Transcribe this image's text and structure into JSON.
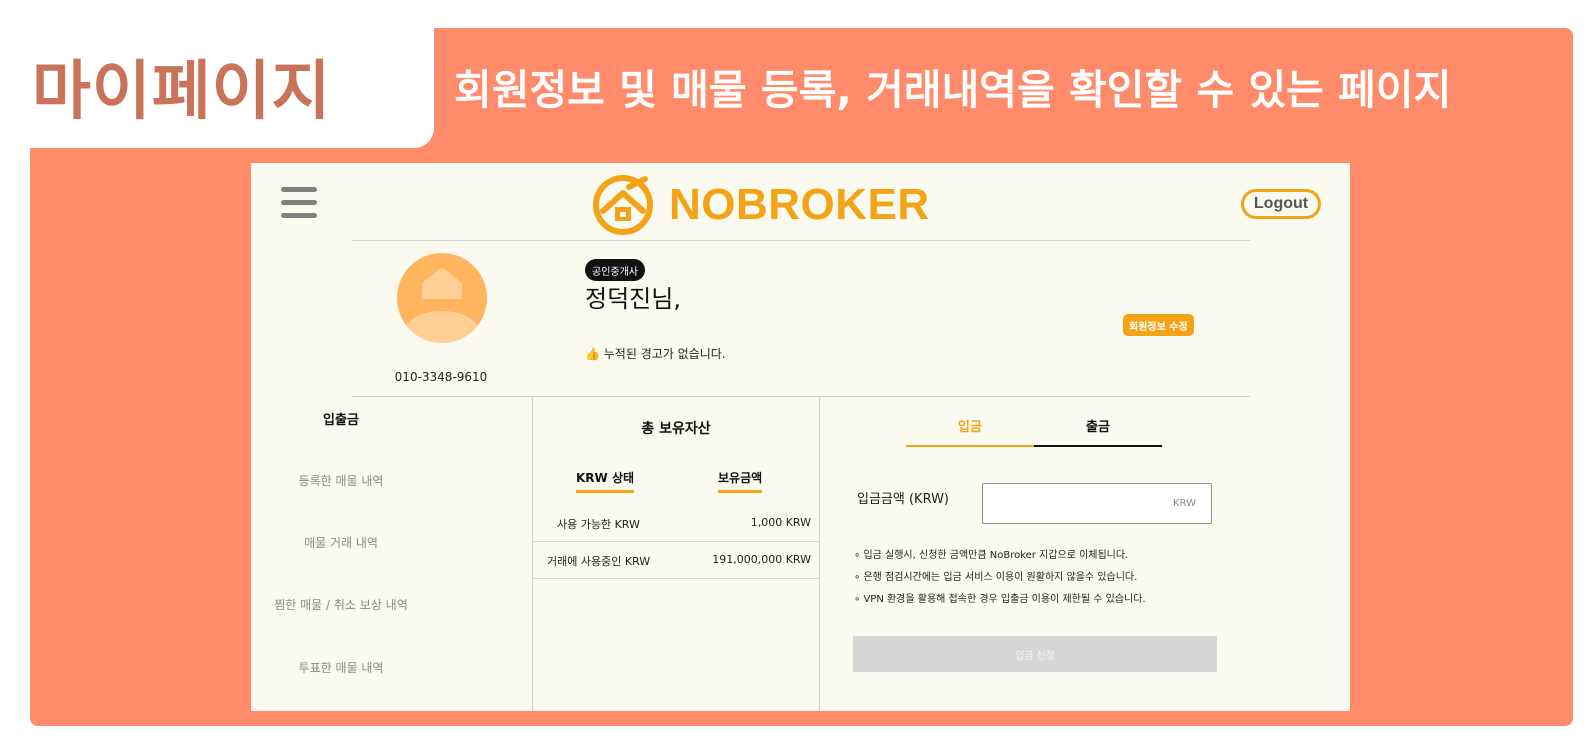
{
  "slide": {
    "title": "마이페이지",
    "subtitle": "회원정보 및 매물 등록, 거래내역을 확인할 수 있는 페이지"
  },
  "colors": {
    "accent": "#f5a316",
    "slide_bg": "#ff8b6a",
    "title_text": "#c8735a"
  },
  "header": {
    "menu_icon": "hamburger-icon",
    "logo_icon": "house-ring-icon",
    "logo_text": "NOBROKER",
    "logout_label": "Logout"
  },
  "profile": {
    "role_badge": "공인중개사",
    "name": "정덕진님,",
    "warning": "👍 누적된 경고가 없습니다.",
    "phone": "010-3348-9610",
    "edit_label": "회원정보 수정",
    "avatar_icon": "user-house-icon"
  },
  "side_menu": [
    {
      "label": "입출금"
    },
    {
      "label": "등록한 매물 내역"
    },
    {
      "label": "매물 거래 내역"
    },
    {
      "label": "찜한 매물 / 취소 보상 내역"
    },
    {
      "label": "투표한 매물 내역"
    }
  ],
  "assets": {
    "title": "총 보유자산",
    "col_status": "KRW 상태",
    "col_amount": "보유금액",
    "rows": [
      {
        "label": "사용 가능한 KRW",
        "value": "1,000 KRW"
      },
      {
        "label": "거래에 사용중인 KRW",
        "value": "191,000,000 KRW"
      }
    ]
  },
  "deposit": {
    "tab_deposit": "입금",
    "tab_withdraw": "출금",
    "amount_label": "입금금액 (KRW)",
    "amount_value": "",
    "unit": "KRW",
    "notices": [
      "입금 실행시, 신청한 금액만큼 NoBroker 지갑으로 이체됩니다.",
      "은행 점검시간에는 입금 서비스 이용이 원활하지 않을수 있습니다.",
      "VPN 환경을 활용해 접속한 경우 입출금 이용이 제한될 수 있습니다."
    ],
    "submit_label": "입금 신청"
  }
}
